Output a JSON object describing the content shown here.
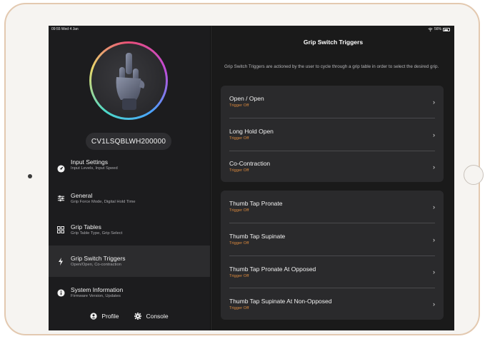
{
  "status_bar": {
    "time": "09:55  Wed 4 Jan",
    "battery": "56%"
  },
  "sidebar": {
    "serial": "CV1LSQBLWH200000",
    "items": [
      {
        "title": "Input Settings",
        "subtitle": "Input Levels, Input Speed",
        "icon": "gauge-icon"
      },
      {
        "title": "General",
        "subtitle": "Grip Force Mode, Digital Hold Time",
        "icon": "sliders-icon"
      },
      {
        "title": "Grip Tables",
        "subtitle": "Grip Table Type, Grip Select",
        "icon": "grid-icon"
      },
      {
        "title": "Grip Switch Triggers",
        "subtitle": "Open/Open, Co-contraction",
        "icon": "lightning-icon"
      },
      {
        "title": "System Information",
        "subtitle": "Firmware Version, Updates",
        "icon": "info-icon"
      }
    ],
    "footer": {
      "profile": "Profile",
      "console": "Console"
    }
  },
  "main": {
    "title": "Grip Switch Triggers",
    "description": "Grip Switch Triggers are actioned by the user to cycle through a grip table in order to select the desired grip.",
    "group1": [
      {
        "title": "Open / Open",
        "status": "Trigger Off"
      },
      {
        "title": "Long Hold Open",
        "status": "Trigger Off"
      },
      {
        "title": "Co-Contraction",
        "status": "Trigger Off"
      }
    ],
    "group2": [
      {
        "title": "Thumb Tap Pronate",
        "status": "Trigger Off"
      },
      {
        "title": "Thumb Tap Supinate",
        "status": "Trigger Off"
      },
      {
        "title": "Thumb Tap Pronate At Opposed",
        "status": "Trigger Off"
      },
      {
        "title": "Thumb Tap Supinate At Non-Opposed",
        "status": "Trigger Off"
      }
    ],
    "chevron": "›"
  },
  "colors": {
    "accent_status": "#d9883d",
    "background": "#111111"
  }
}
